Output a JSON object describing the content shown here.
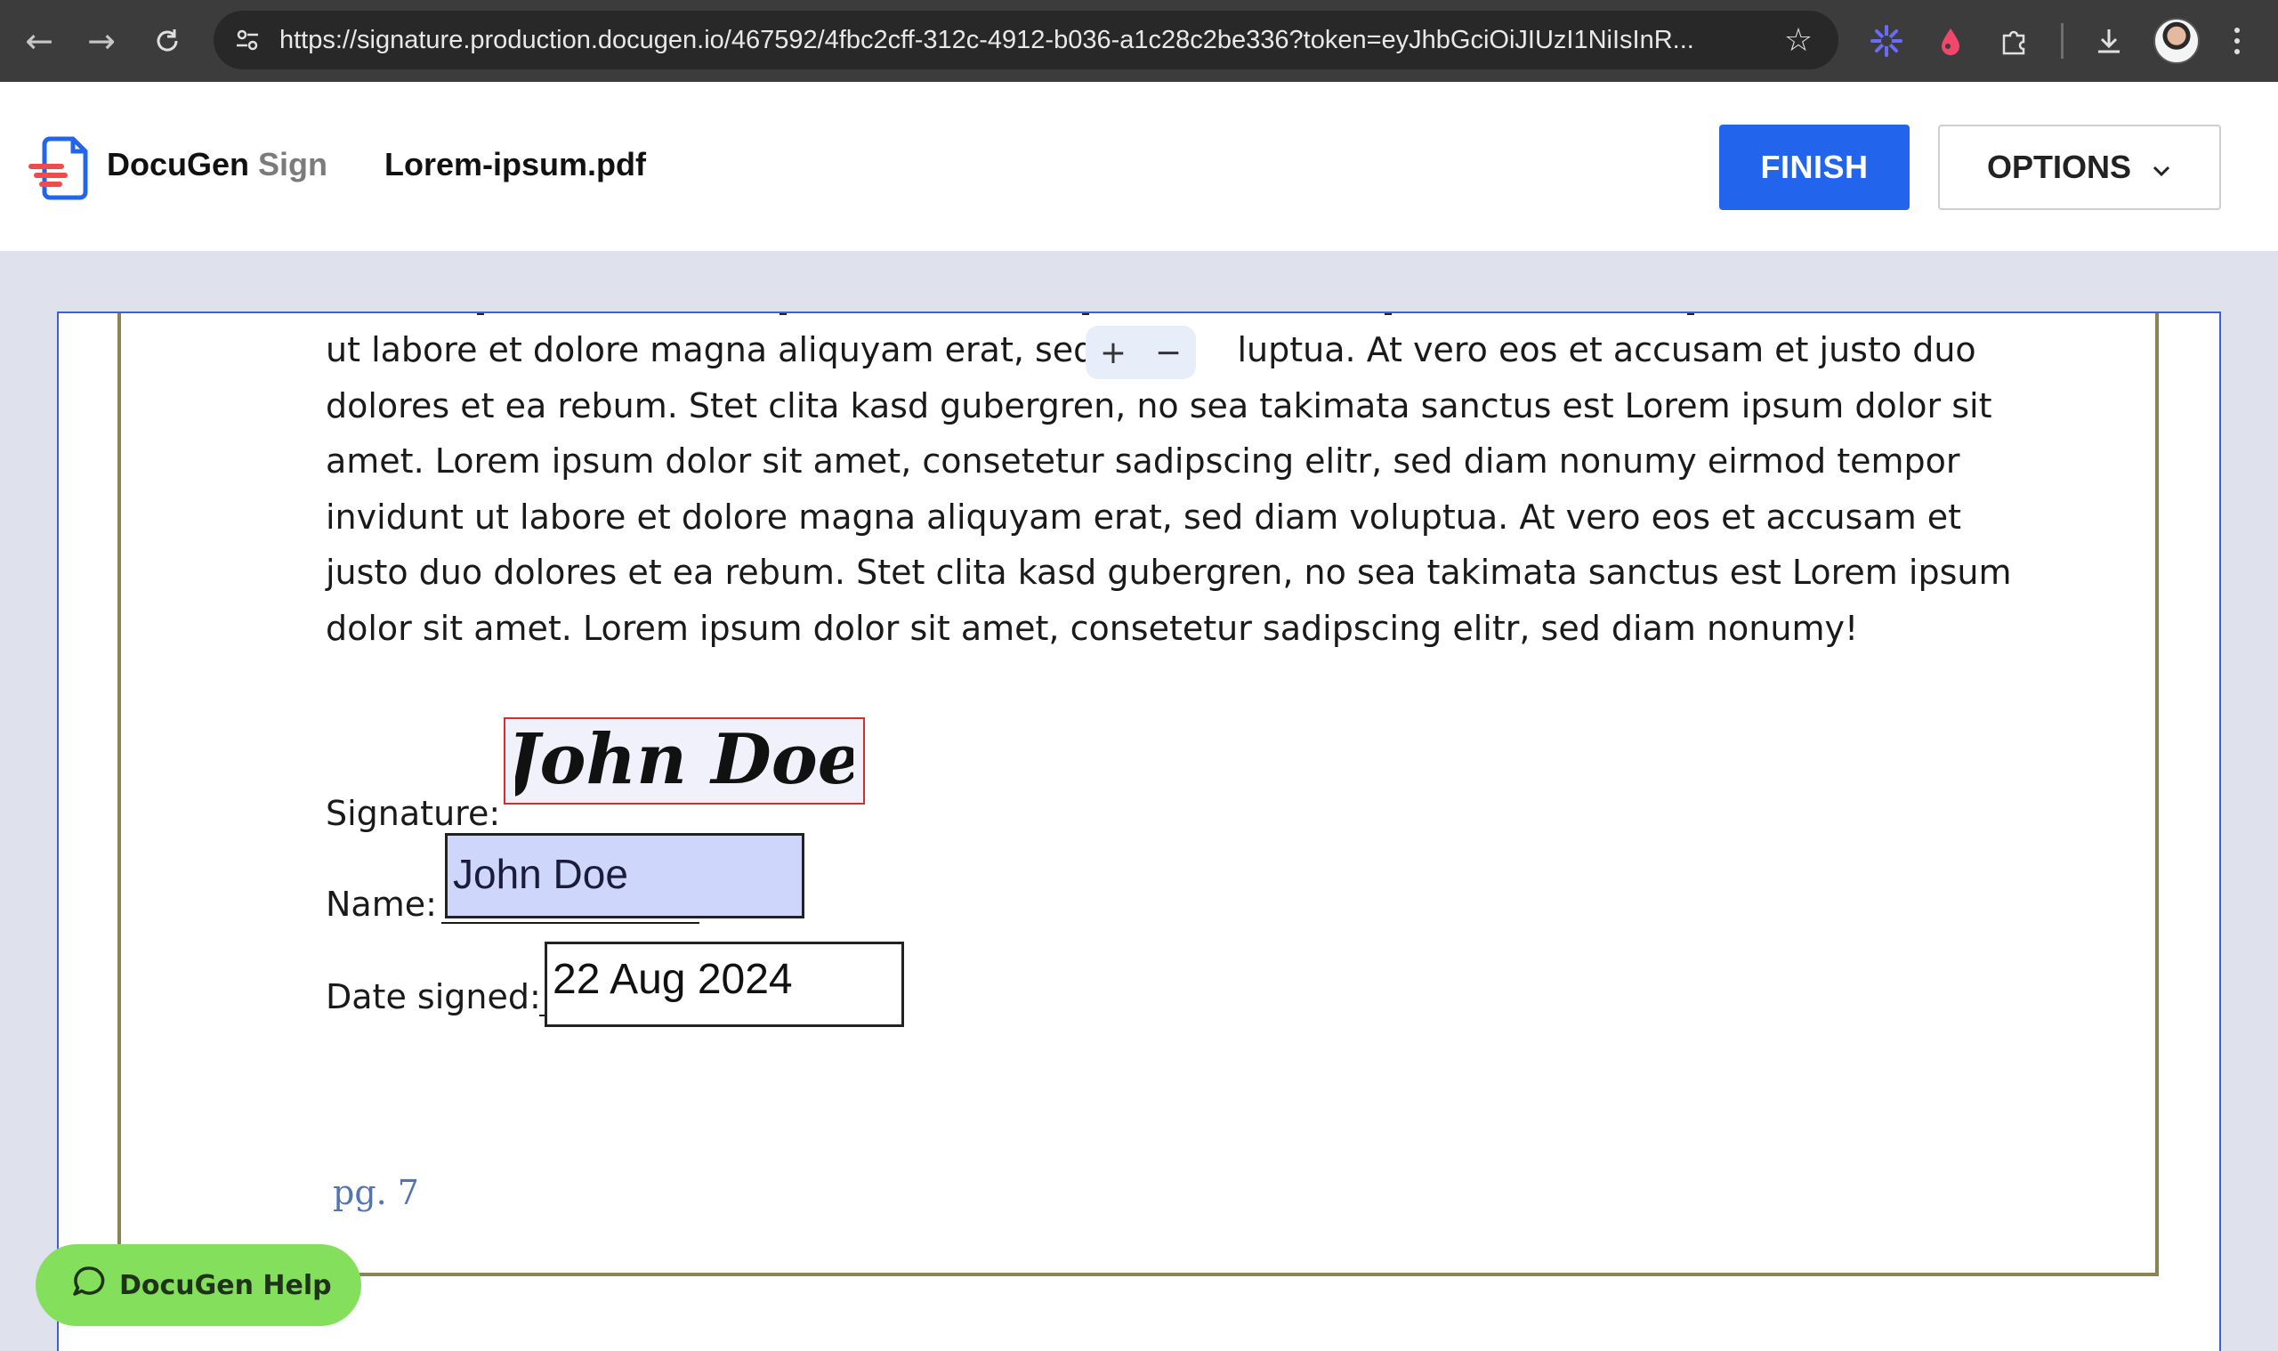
{
  "browser": {
    "url": "https://signature.production.docugen.io/467592/4fbc2cff-312c-4912-b036-a1c28c2be336?token=eyJhbGciOiJIUzI1NiIsInR..."
  },
  "header": {
    "brand_name": "DocuGen",
    "brand_suffix": "Sign",
    "file_name": "Lorem-ipsum.pdf",
    "finish_label": "FINISH",
    "options_label": "OPTIONS",
    "accent_color": "#2364ec"
  },
  "document": {
    "paragraph_lines": [
      "ut labore et dolore magna aliquyam erat, sed d",
      "dolores et ea rebum. Stet clita kasd gubergren, no sea takimata sanctus est Lorem ipsum dolor sit",
      "amet. Lorem ipsum dolor sit amet, consetetur sadipscing elitr, sed diam nonumy eirmod tempor",
      "invidunt ut labore et dolore magna aliquyam erat, sed diam voluptua. At vero eos et accusam et",
      "justo duo dolores et ea rebum. Stet clita kasd gubergren, no sea takimata sanctus est Lorem ipsum",
      "dolor sit amet. Lorem ipsum dolor sit amet, consetetur sadipscing elitr, sed diam nonumy!"
    ],
    "line1_tail": "luptua. At vero eos et accusam et justo duo",
    "zoom_in": "+",
    "zoom_out": "−",
    "signature_label": "Signature:",
    "signature_value": "John Doe",
    "name_label": "Name:",
    "name_value": "John Doe",
    "date_label": "Date signed:",
    "date_value": "22 Aug 2024",
    "page_number": "pg. 7"
  },
  "help": {
    "label": "DocuGen Help",
    "color": "#84e05c"
  }
}
